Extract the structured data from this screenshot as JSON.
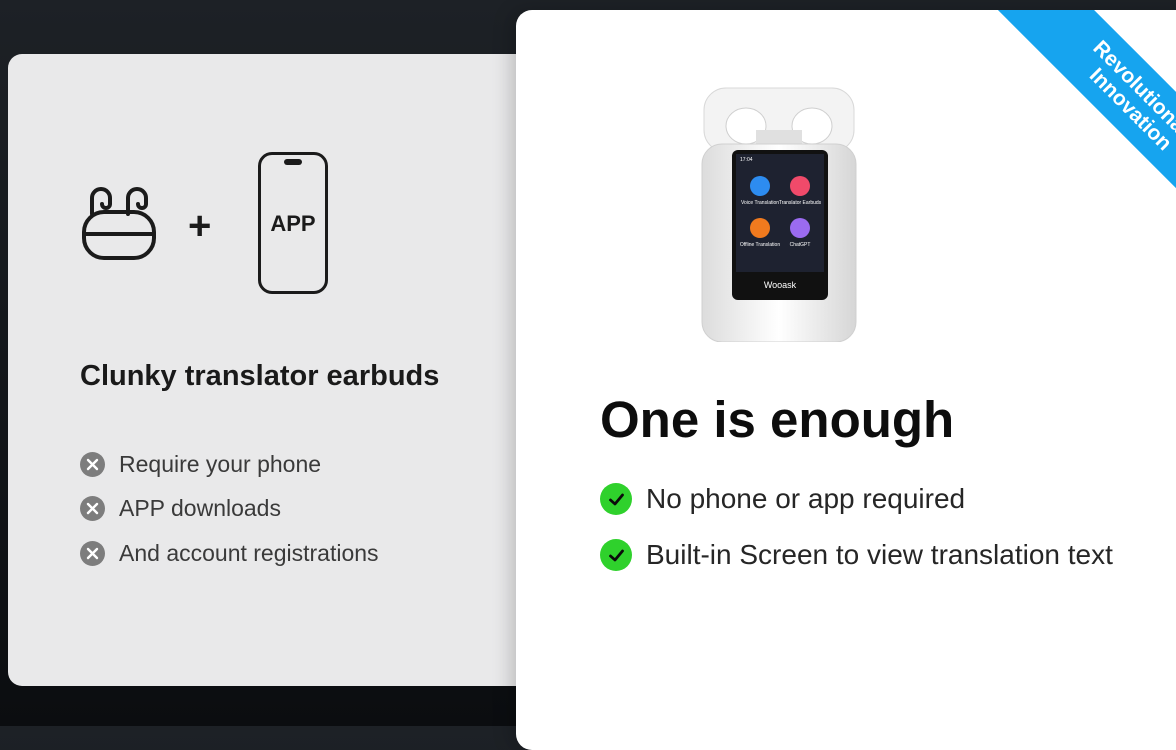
{
  "left": {
    "icons": [
      "earbuds-case-icon",
      "plus-icon",
      "phone-icon"
    ],
    "phone_label": "APP",
    "plus": "+",
    "title": "Clunky translator earbuds",
    "items": [
      "Require your phone",
      "APP downloads",
      "And account registrations"
    ]
  },
  "right": {
    "ribbon": {
      "line1": "Revolutionary",
      "line2": "Innovation"
    },
    "device": {
      "time": "17:04",
      "apps": [
        "Voice Translation",
        "Translator Earbuds",
        "Offline Translation",
        "ChatGPT"
      ],
      "brand": "Wooask"
    },
    "title": "One is enough",
    "items": [
      "No phone or app required",
      "Built-in Screen to view translation text"
    ]
  },
  "colors": {
    "background": "#14171b",
    "left_card": "#e9e9ea",
    "right_card": "#ffffff",
    "ribbon": "#16a4ef",
    "check": "#2fd12c",
    "cross": "#7d7d7d"
  }
}
